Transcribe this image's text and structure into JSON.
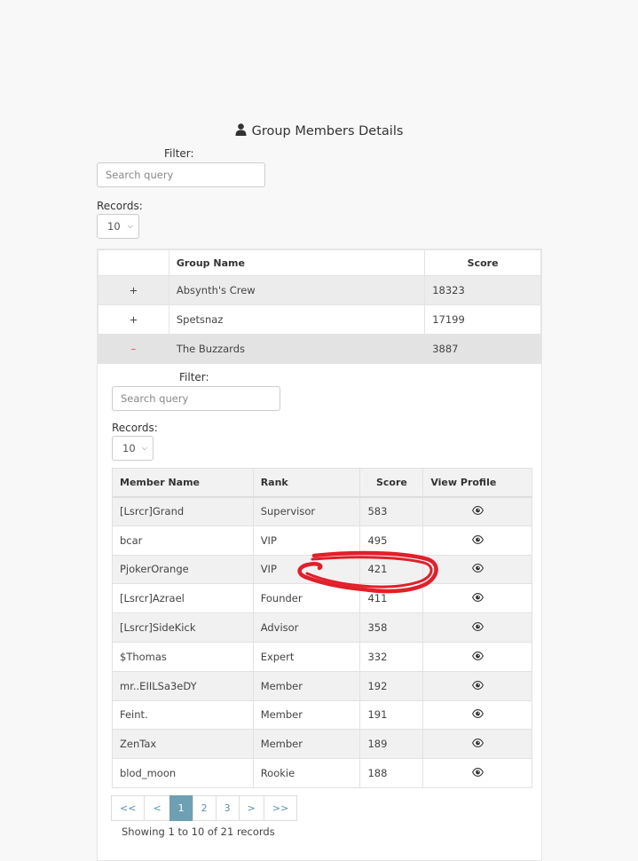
{
  "page": {
    "title": "Group Members Details",
    "title_icon": "user-icon"
  },
  "outer_filter": {
    "filter_label": "Filter:",
    "search_placeholder": "Search query",
    "records_label": "Records:",
    "records_value": "10"
  },
  "groups": {
    "headers": {
      "toggle": "",
      "name": "Group Name",
      "score": "Score"
    },
    "rows": [
      {
        "toggle": "+",
        "name": "Absynth's Crew",
        "score": "18323"
      },
      {
        "toggle": "+",
        "name": "Spetsnaz",
        "score": "17199"
      },
      {
        "toggle": "–",
        "name": "The Buzzards",
        "score": "3887"
      }
    ]
  },
  "inner_filter": {
    "filter_label": "Filter:",
    "search_placeholder": "Search query",
    "records_label": "Records:",
    "records_value": "10"
  },
  "members": {
    "headers": {
      "name": "Member Name",
      "rank": "Rank",
      "score": "Score",
      "profile": "View Profile"
    },
    "rows": [
      {
        "name": "[Lsrcr]Grand",
        "rank": "Supervisor",
        "score": "583"
      },
      {
        "name": "bcar",
        "rank": "VIP",
        "score": "495"
      },
      {
        "name": "PjokerOrange",
        "rank": "VIP",
        "score": "421"
      },
      {
        "name": "[Lsrcr]Azrael",
        "rank": "Founder",
        "score": "411"
      },
      {
        "name": "[Lsrcr]SideKick",
        "rank": "Advisor",
        "score": "358"
      },
      {
        "name": "$Thomas",
        "rank": "Expert",
        "score": "332"
      },
      {
        "name": "mr..EIILSa3eDY",
        "rank": "Member",
        "score": "192"
      },
      {
        "name": "Feint.",
        "rank": "Member",
        "score": "191"
      },
      {
        "name": "ZenTax",
        "rank": "Member",
        "score": "189"
      },
      {
        "name": "blod_moon",
        "rank": "Rookie",
        "score": "188"
      }
    ],
    "profile_icon": "eye-icon"
  },
  "pagination": {
    "first": "<<",
    "prev": "<",
    "pages": [
      "1",
      "2",
      "3"
    ],
    "active_page": "1",
    "next": ">",
    "last": ">>",
    "showing": "Showing 1 to 10 of 21 records"
  },
  "annotation": {
    "color": "#e0202a"
  }
}
